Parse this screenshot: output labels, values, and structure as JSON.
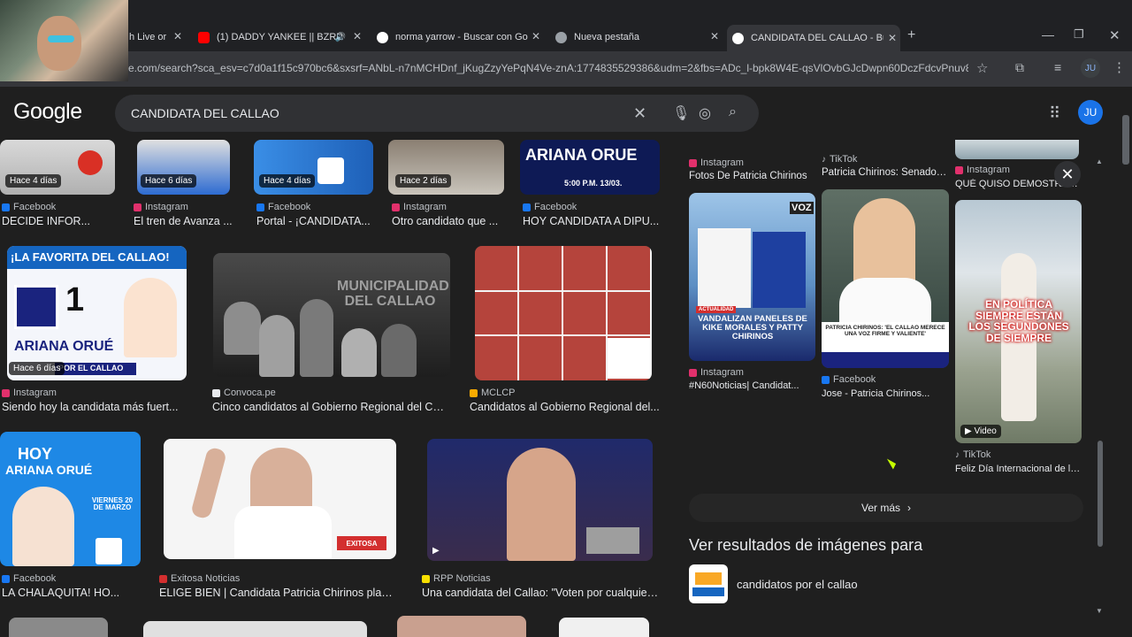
{
  "browser": {
    "tabs": [
      {
        "label": "h Live or",
        "active": false
      },
      {
        "label": "(1) DADDY YANKEE || BZRP",
        "active": false
      },
      {
        "label": "norma yarrow - Buscar con Goo",
        "active": false
      },
      {
        "label": "Nueva pestaña",
        "active": false
      },
      {
        "label": "CANDIDATA DEL CALLAO - Bus",
        "active": true
      }
    ],
    "url": "e.com/search?sca_esv=c7d0a1f15c970bc6&sxsrf=ANbL-n7nMCHDnf_jKugZzyYePqN4Ve-znA:1774835529386&udm=2&fbs=ADc_l-bpk8W4E-qsVlOvbGJcDwpn60DczFdcvPnuv8WQ...",
    "profile": "JU"
  },
  "search": {
    "logo": "Google",
    "query": "CANDIDATA DEL CALLAO"
  },
  "results": {
    "row1": [
      {
        "badge": "Hace 4 días",
        "source": "Facebook",
        "caption": "DECIDE INFOR..."
      },
      {
        "badge": "Hace 6 días",
        "source": "Instagram",
        "caption": "El tren de Avanza ..."
      },
      {
        "badge": "Hace 4 días",
        "source": "Facebook",
        "caption": "Portal - ¡CANDIDATA..."
      },
      {
        "badge": "Hace 2 días",
        "source": "Instagram",
        "caption": "Otro candidato que ..."
      },
      {
        "badge": "",
        "source": "Facebook",
        "caption": "HOY CANDIDATA A DIPU..."
      }
    ],
    "row2": [
      {
        "badge": "Hace 6 días",
        "source": "Instagram",
        "caption": "Siendo hoy la candidata más fuert...",
        "poster_top": "¡LA FAVORITA DEL CALLAO!",
        "poster_name": "ARIANA ORUÉ",
        "poster_sub": "POR EL CALLAO"
      },
      {
        "source": "Convoca.pe",
        "caption": "Cinco candidatos al Gobierno Regional del Cal...",
        "poster_top": "MUNICIPALIDAD DEL CALLAO"
      },
      {
        "source": "MCLCP",
        "caption": "Candidatos al Gobierno Regional del..."
      }
    ],
    "row3": [
      {
        "source": "Facebook",
        "caption": "LA CHALAQUITA! HO...",
        "poster_top": "HOY",
        "poster_name": "ARIANA ORUÉ",
        "poster_sub": "VIERNES 20 DE MARZO"
      },
      {
        "source": "Exitosa Noticias",
        "caption": "ELIGE BIEN | Candidata Patricia Chirinos plant..."
      },
      {
        "source": "RPP Noticias",
        "caption": "Una candidata del Callao: \"Voten por cualquier..."
      }
    ],
    "row1_poster": {
      "name": "ARIANA ORUE",
      "time": "5:00 P.M.  13/03."
    }
  },
  "panel": {
    "top": [
      {
        "source": "Instagram",
        "caption": "Fotos De Patricia Chirinos"
      },
      {
        "source": "TikTok",
        "caption": "Patricia Chirinos: Senadora..."
      },
      {
        "source": "Instagram",
        "caption": "QUÉ QUISO DEMOSTRAR..."
      }
    ],
    "cards": [
      {
        "source": "Instagram",
        "caption": "#N60Noticias| Candidat...",
        "poster": "VANDALIZAN PANELES DE KIKE MORALES Y PATTY CHIRINOS",
        "tag": "ACTUALIDAD"
      },
      {
        "source": "Facebook",
        "caption": "Jose - Patricia Chirinos...",
        "poster": "PATRICIA CHIRINOS: 'EL CALLAO MERECE UNA VOZ FIRME Y VALIENTE'"
      },
      {
        "source": "TikTok",
        "caption": "Feliz Día Internacional de la...",
        "poster": "EN POLÍTICA SIEMPRE ESTÁN LOS SEGUNDONES DE SIEMPRE",
        "badge": "Video"
      }
    ],
    "more_button": "Ver más",
    "related_heading": "Ver resultados de imágenes para",
    "related_item": "candidatos por el callao"
  },
  "colors": {
    "facebook": "#1877f2",
    "instagram": "#e1306c",
    "tiktok": "#ffffff",
    "accent": "#8ab4f8"
  }
}
